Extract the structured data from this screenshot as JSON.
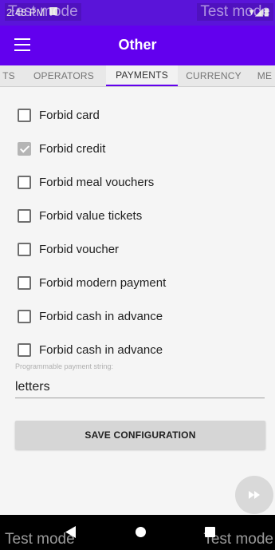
{
  "status_bar": {
    "time": "2:48 PM",
    "icons": "▾◢▮",
    "watermark_left": "Test mode",
    "watermark_right": "Test mode"
  },
  "app_bar": {
    "title": "Other",
    "background": "#6200ee"
  },
  "tabs": [
    {
      "label": "TS",
      "active": false
    },
    {
      "label": "OPERATORS",
      "active": false
    },
    {
      "label": "PAYMENTS",
      "active": true
    },
    {
      "label": "CURRENCY",
      "active": false
    },
    {
      "label": "ME",
      "active": false
    }
  ],
  "options": [
    {
      "label": "Forbid card",
      "checked": false
    },
    {
      "label": "Forbid credit",
      "checked": true
    },
    {
      "label": "Forbid meal vouchers",
      "checked": false
    },
    {
      "label": "Forbid value tickets",
      "checked": false
    },
    {
      "label": "Forbid voucher",
      "checked": false
    },
    {
      "label": "Forbid modern payment",
      "checked": false
    },
    {
      "label": "Forbid cash in advance",
      "checked": false
    },
    {
      "label": "Forbid cash in advance",
      "checked": false
    }
  ],
  "payment_string": {
    "caption": "Programmable payment string:",
    "value": "letters"
  },
  "save_button": {
    "label": "SAVE CONFIGURATION"
  },
  "nav_bar": {
    "watermark_left": "Test mode",
    "watermark_right": "Test mode"
  }
}
